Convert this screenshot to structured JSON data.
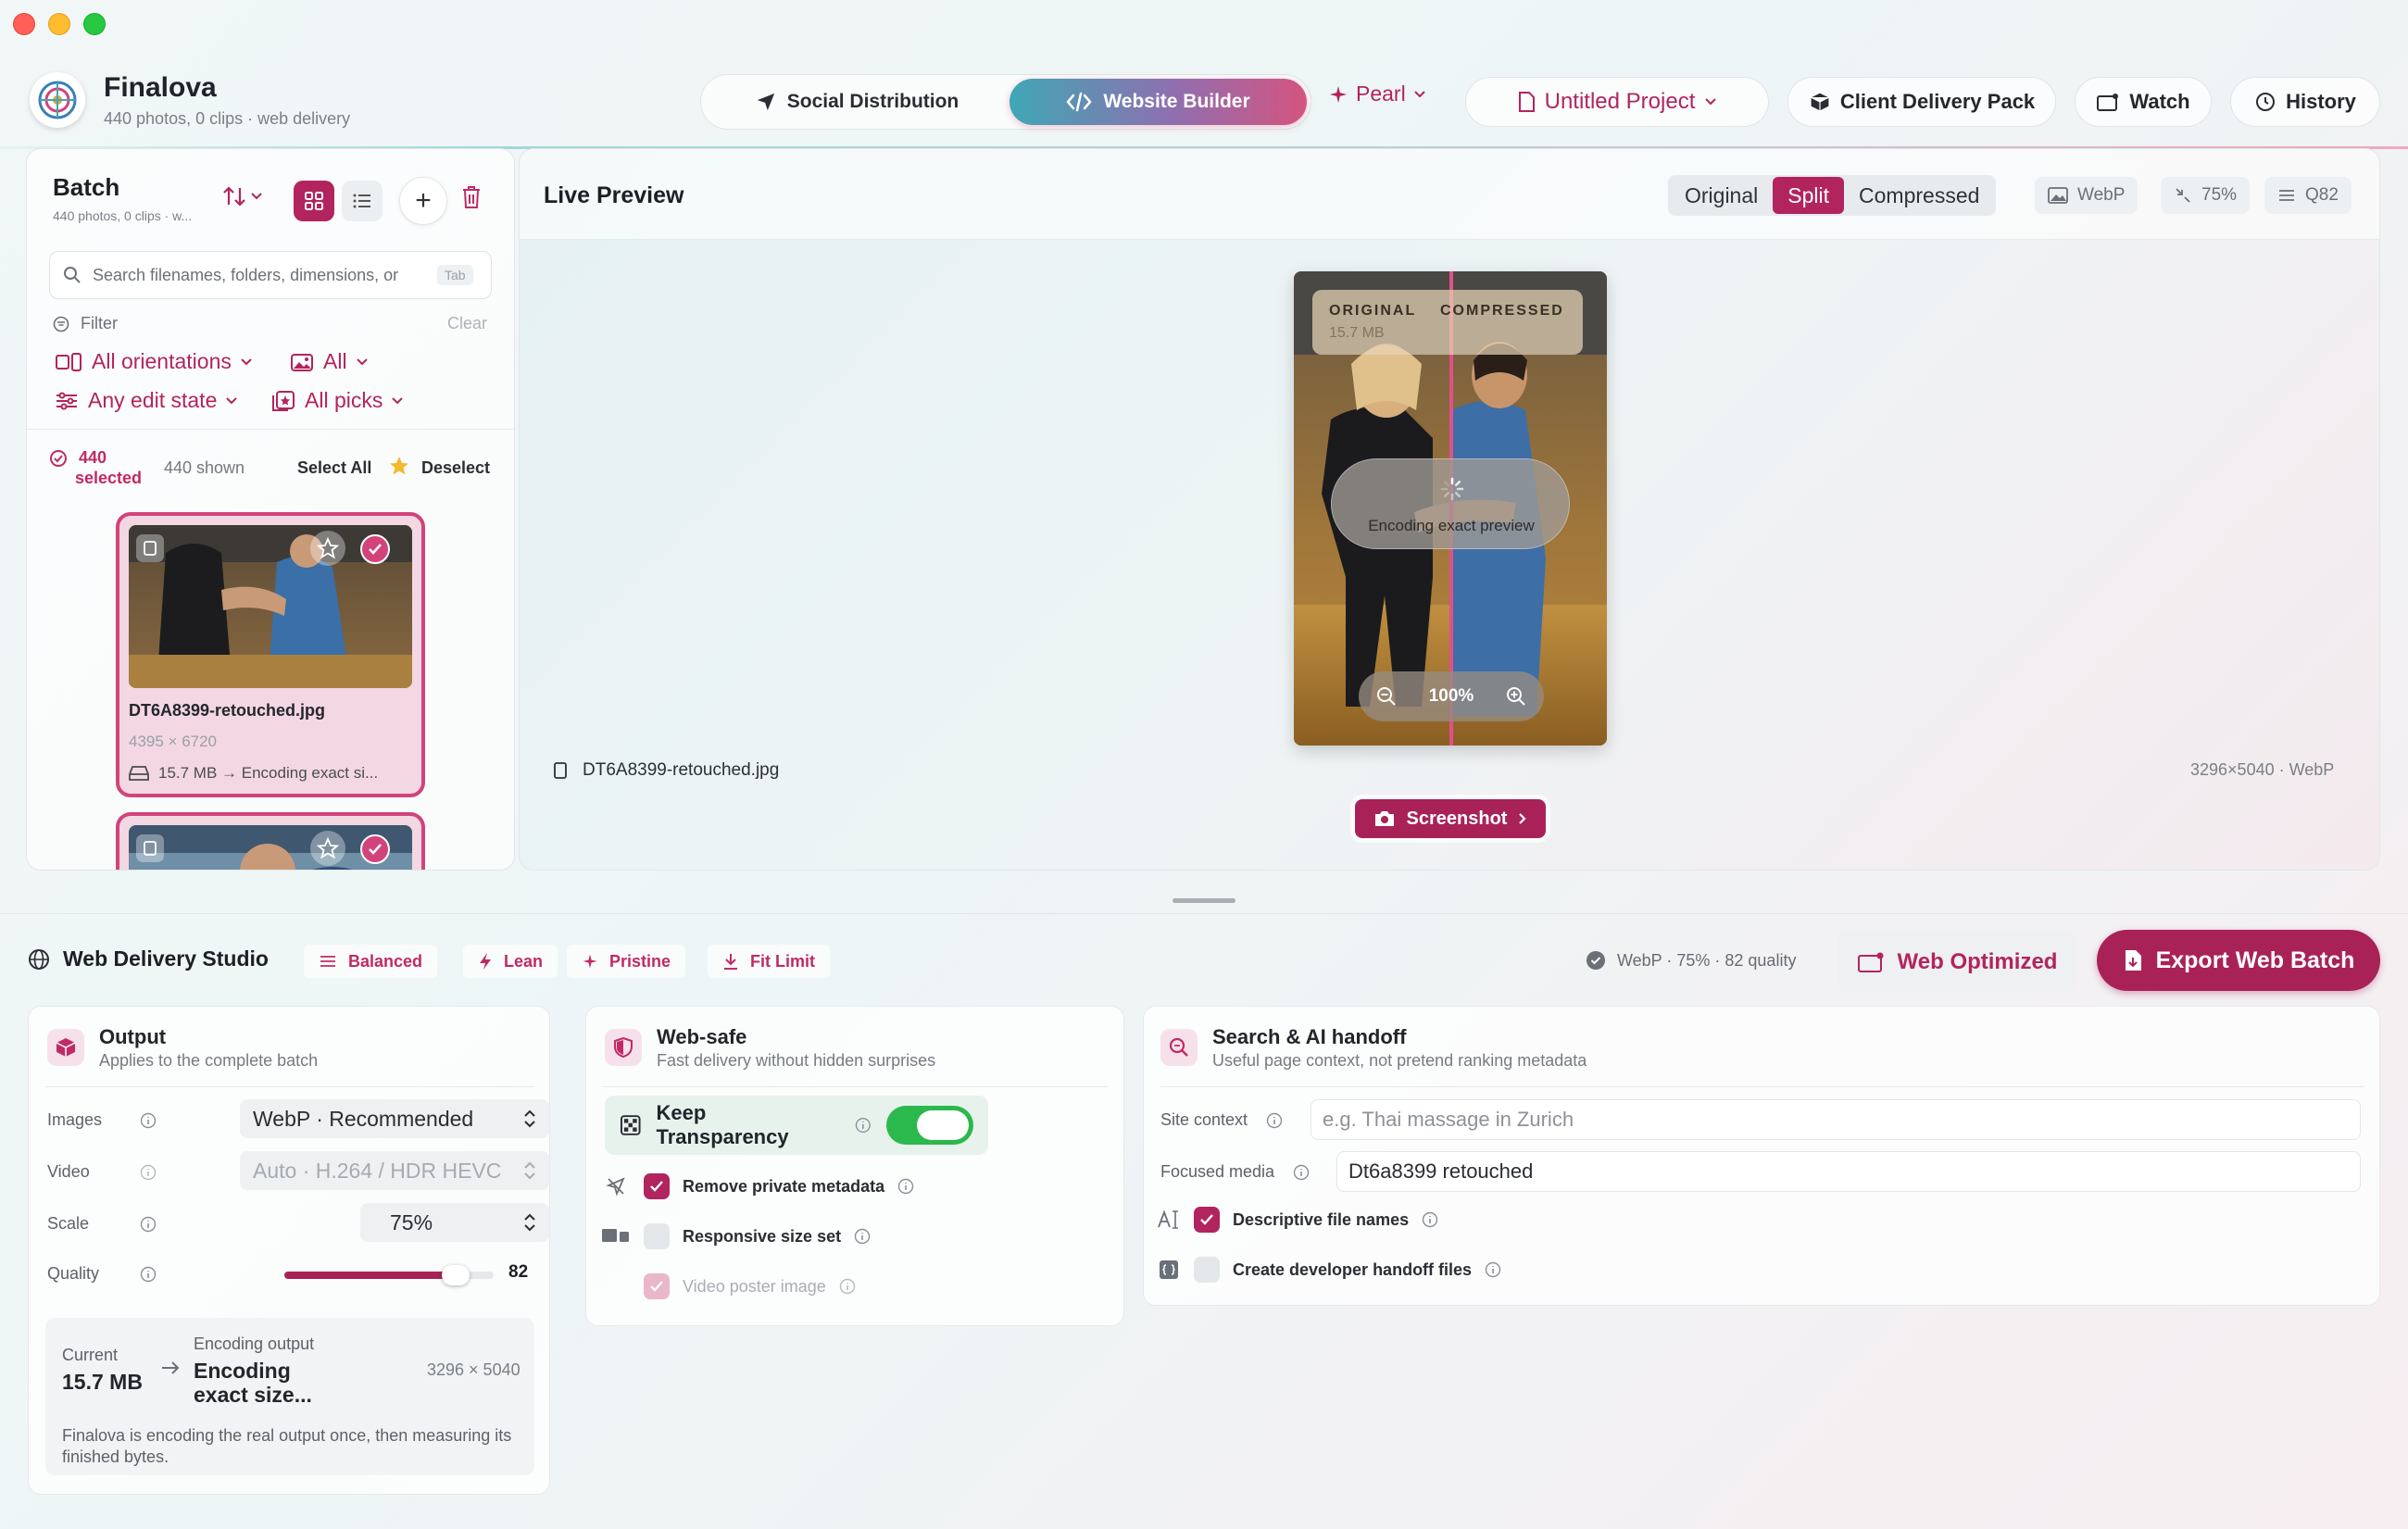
{
  "app": {
    "name": "Finalova",
    "subtitle": "440 photos, 0 clips · web delivery"
  },
  "header": {
    "modes": [
      {
        "label": "Social Distribution",
        "active": false
      },
      {
        "label": "Website Builder",
        "active": true
      }
    ],
    "pearl_label": "Pearl",
    "project_label": "Untitled Project",
    "client_delivery_label": "Client Delivery Pack",
    "watch_label": "Watch",
    "history_label": "History"
  },
  "batch": {
    "title": "Batch",
    "subtitle": "440 photos, 0 clips · w...",
    "search_placeholder": "Search filenames, folders, dimensions, or",
    "search_hint": "Tab",
    "filter_label": "Filter",
    "clear_label": "Clear",
    "filters": {
      "orientation": "All orientations",
      "media": "All",
      "edit_state": "Any edit state",
      "picks": "All picks"
    },
    "selected_count": "440",
    "selected_word": "selected",
    "shown_label": "440 shown",
    "select_all_label": "Select All",
    "deselect_label": "Deselect",
    "items": [
      {
        "filename": "DT6A8399-retouched.jpg",
        "dimensions": "4395 × 6720",
        "size_line": "15.7 MB → Encoding exact si..."
      }
    ]
  },
  "preview": {
    "title": "Live Preview",
    "segments": [
      {
        "label": "Original",
        "active": false
      },
      {
        "label": "Split",
        "active": true
      },
      {
        "label": "Compressed",
        "active": false
      }
    ],
    "chips": {
      "format": "WebP",
      "scale": "75%",
      "quality": "Q82"
    },
    "badge_original": "ORIGINAL",
    "badge_original_size": "15.7 MB",
    "badge_compressed": "COMPRESSED",
    "encoding_text": "Encoding exact preview",
    "zoom": "100%",
    "filename": "DT6A8399-retouched.jpg",
    "output_dims": "3296×5040 · WebP",
    "screenshot_label": "Screenshot"
  },
  "studio": {
    "title": "Web Delivery Studio",
    "presets": [
      "Balanced",
      "Lean",
      "Pristine",
      "Fit Limit"
    ],
    "summary": "WebP · 75% · 82 quality",
    "web_optimized_label": "Web Optimized",
    "export_label": "Export Web Batch",
    "output": {
      "title": "Output",
      "subtitle": "Applies to the complete batch",
      "images_label": "Images",
      "images_value": "WebP · Recommended",
      "video_label": "Video",
      "video_value": "Auto · H.264 / HDR HEVC",
      "scale_label": "Scale",
      "scale_value": "75%",
      "quality_label": "Quality",
      "quality_value": "82",
      "quality_fraction": 0.82,
      "current_label": "Current",
      "current_value": "15.7 MB",
      "encoding_label": "Encoding output",
      "encoding_value_1": "Encoding",
      "encoding_value_2": "exact size...",
      "encoding_dims": "3296 × 5040",
      "note": "Finalova is encoding the real output once, then measuring its finished bytes."
    },
    "websafe": {
      "title": "Web-safe",
      "subtitle": "Fast delivery without hidden surprises",
      "keep_transparency_label": "Keep Transparency",
      "keep_transparency_on": true,
      "options": [
        {
          "label": "Remove private metadata",
          "checked": true,
          "disabled": false
        },
        {
          "label": "Responsive size set",
          "checked": false,
          "disabled": false
        },
        {
          "label": "Video poster image",
          "checked": true,
          "disabled": true
        }
      ]
    },
    "seo": {
      "title": "Search & AI handoff",
      "subtitle": "Useful page context, not pretend ranking metadata",
      "site_context_label": "Site context",
      "site_context_placeholder": "e.g. Thai massage in Zurich",
      "focused_media_label": "Focused media",
      "focused_media_value": "Dt6a8399 retouched",
      "options": [
        {
          "label": "Descriptive file names",
          "checked": true
        },
        {
          "label": "Create developer handoff files",
          "checked": false
        }
      ]
    }
  },
  "colors": {
    "accent": "#b2245e",
    "accent_dark": "#a82258",
    "toggle_green": "#2bb84c"
  }
}
